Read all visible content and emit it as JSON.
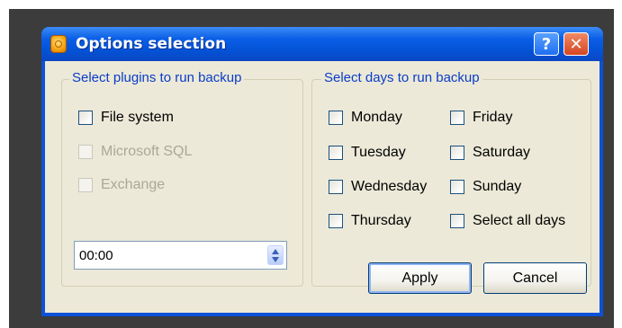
{
  "window": {
    "title": "Options selection",
    "help_symbol": "?",
    "close_symbol": "✕"
  },
  "plugins": {
    "legend": "Select plugins to run backup",
    "items": [
      {
        "label": "File system",
        "checked": false,
        "enabled": true
      },
      {
        "label": "Microsoft SQL",
        "checked": false,
        "enabled": false
      },
      {
        "label": "Exchange",
        "checked": false,
        "enabled": false
      }
    ],
    "time_value": "00:00"
  },
  "days": {
    "legend": "Select days to run backup",
    "items": [
      {
        "label": "Monday",
        "checked": false
      },
      {
        "label": "Tuesday",
        "checked": false
      },
      {
        "label": "Wednesday",
        "checked": false
      },
      {
        "label": "Thursday",
        "checked": false
      },
      {
        "label": "Friday",
        "checked": false
      },
      {
        "label": "Saturday",
        "checked": false
      },
      {
        "label": "Sunday",
        "checked": false
      },
      {
        "label": "Select all days",
        "checked": false
      }
    ]
  },
  "buttons": {
    "apply": "Apply",
    "cancel": "Cancel"
  },
  "colors": {
    "titlebar": "#0a5ee6",
    "client_bg": "#ece9d8",
    "legend_text": "#0a3cc8",
    "disabled_text": "#aca899"
  }
}
